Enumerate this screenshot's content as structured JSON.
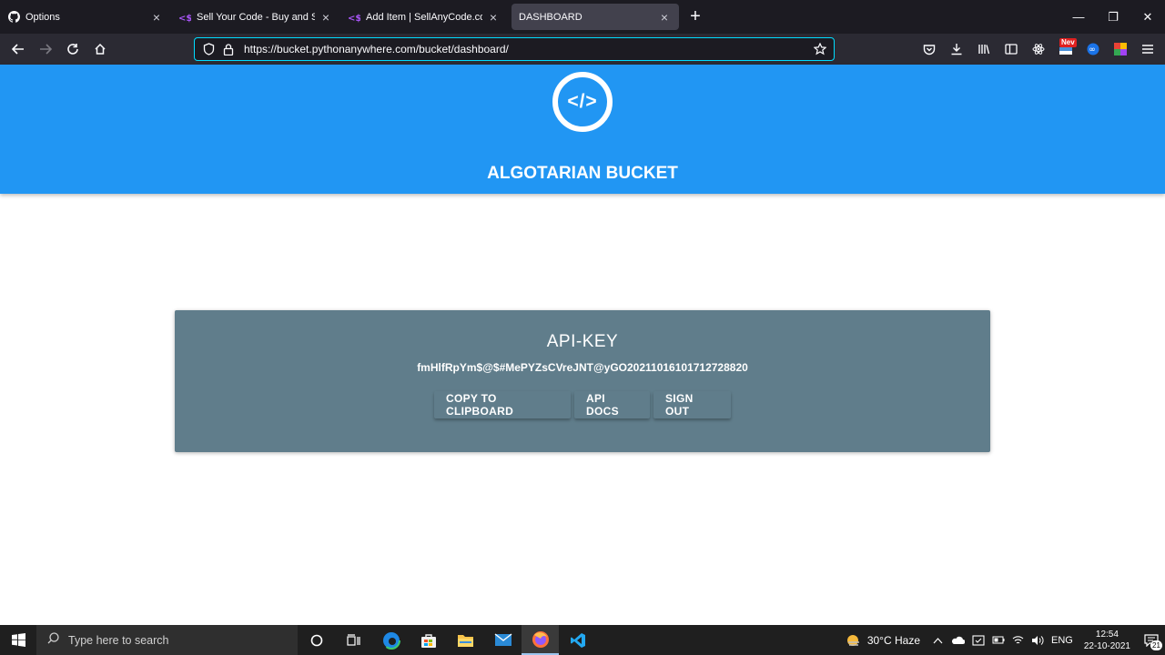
{
  "browser": {
    "tabs": [
      {
        "label": "Options",
        "icon": "github-icon"
      },
      {
        "label": "Sell Your Code - Buy and Sell M",
        "icon": "sellanycode-icon"
      },
      {
        "label": "Add Item | SellAnyCode.com",
        "icon": "sellanycode-icon"
      },
      {
        "label": "DASHBOARD",
        "icon": "",
        "active": true
      }
    ],
    "new_tab": "+",
    "url": "https://bucket.pythonanywhere.com/bucket/dashboard/",
    "extension_badge": "Nev"
  },
  "page": {
    "logo_glyph": "</>",
    "site_title": "ALGOTARIAN BUCKET",
    "card": {
      "title": "API-KEY",
      "api_key": "fmHlfRpYm$@$#MePYZsCVreJNT@yGO20211016101712728820",
      "buttons": {
        "copy": "COPY TO CLIPBOARD",
        "docs": "API DOCS",
        "signout": "SIGN OUT"
      }
    },
    "colors": {
      "header": "#2196f3",
      "card": "#607d8b"
    }
  },
  "taskbar": {
    "search_placeholder": "Type here to search",
    "weather": "30°C  Haze",
    "language": "ENG",
    "time": "12:54",
    "date": "22-10-2021",
    "notification_count": "21"
  }
}
